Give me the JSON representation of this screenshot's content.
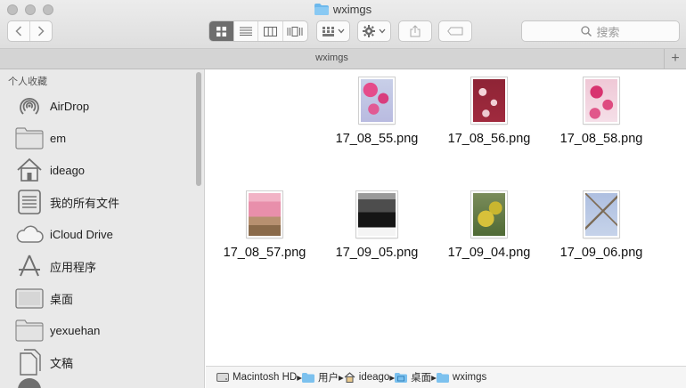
{
  "window": {
    "title": "wximgs"
  },
  "toolbar": {
    "search_placeholder": "搜索"
  },
  "tabbar": {
    "title": "wximgs",
    "add_label": "+"
  },
  "sidebar": {
    "header": "个人收藏",
    "items": [
      {
        "label": "AirDrop",
        "icon": "airdrop-icon"
      },
      {
        "label": "em",
        "icon": "folder-icon"
      },
      {
        "label": "ideago",
        "icon": "home-icon"
      },
      {
        "label": "我的所有文件",
        "icon": "all-files-icon"
      },
      {
        "label": "iCloud Drive",
        "icon": "cloud-icon"
      },
      {
        "label": "应用程序",
        "icon": "applications-icon"
      },
      {
        "label": "桌面",
        "icon": "desktop-icon"
      },
      {
        "label": "yexuehan",
        "icon": "folder-icon"
      },
      {
        "label": "文稿",
        "icon": "documents-icon"
      }
    ]
  },
  "files": [
    {
      "name": "17_08_55.png"
    },
    {
      "name": "17_08_56.png"
    },
    {
      "name": "17_08_58.png"
    },
    {
      "name": "17_08_57.png"
    },
    {
      "name": "17_09_05.png"
    },
    {
      "name": "17_09_04.png"
    },
    {
      "name": "17_09_06.png"
    }
  ],
  "pathbar": {
    "crumbs": [
      {
        "label": "Macintosh HD",
        "icon": "disk-icon"
      },
      {
        "label": "用户",
        "icon": "folder-icon"
      },
      {
        "label": "ideago",
        "icon": "home-icon"
      },
      {
        "label": "桌面",
        "icon": "desktop-folder-icon"
      },
      {
        "label": "wximgs",
        "icon": "folder-icon"
      }
    ]
  }
}
